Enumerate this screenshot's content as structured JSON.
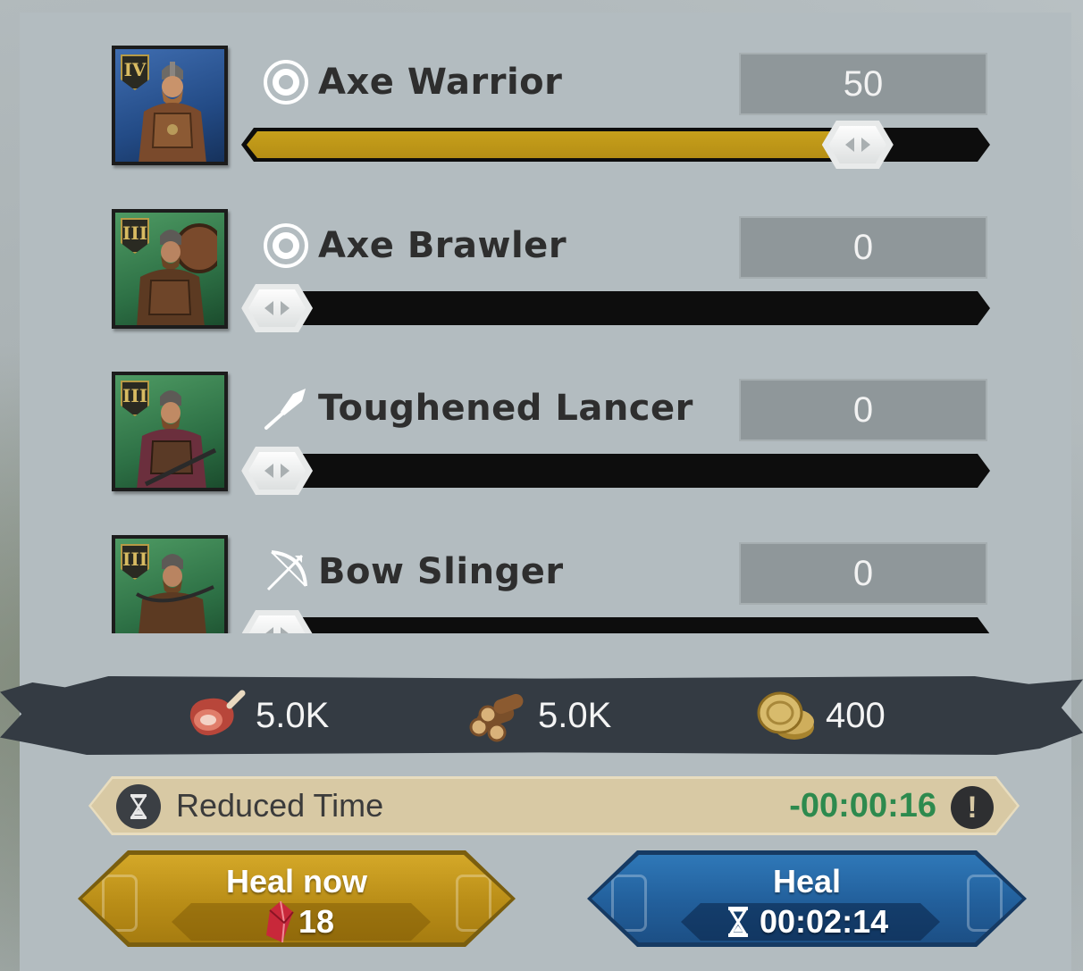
{
  "units": [
    {
      "name": "Axe Warrior",
      "tier": "IV",
      "type_icon": "shield-icon",
      "portrait_color": "blue",
      "value": "50",
      "slider_fraction": 0.9
    },
    {
      "name": "Axe Brawler",
      "tier": "III",
      "type_icon": "shield-icon",
      "portrait_color": "green",
      "value": "0",
      "slider_fraction": 0
    },
    {
      "name": "Toughened Lancer",
      "tier": "III",
      "type_icon": "spear-icon",
      "portrait_color": "green",
      "value": "0",
      "slider_fraction": 0
    },
    {
      "name": "Bow Slinger",
      "tier": "III",
      "type_icon": "bow-icon",
      "portrait_color": "green",
      "value": "0",
      "slider_fraction": 0
    }
  ],
  "resources": [
    {
      "icon": "meat-icon",
      "value": "5.0K"
    },
    {
      "icon": "wood-icon",
      "value": "5.0K"
    },
    {
      "icon": "gold-coins-icon",
      "value": "400"
    }
  ],
  "reduced_time": {
    "label": "Reduced Time",
    "value": "-00:00:16",
    "value_color": "#2d8a4e"
  },
  "buttons": {
    "heal_now": {
      "label": "Heal now",
      "cost": "18",
      "cost_icon": "ruby-gem-icon",
      "color": "#c99d20"
    },
    "heal": {
      "label": "Heal",
      "time": "00:02:14",
      "time_icon": "hourglass-icon",
      "color": "#2569a7"
    }
  }
}
